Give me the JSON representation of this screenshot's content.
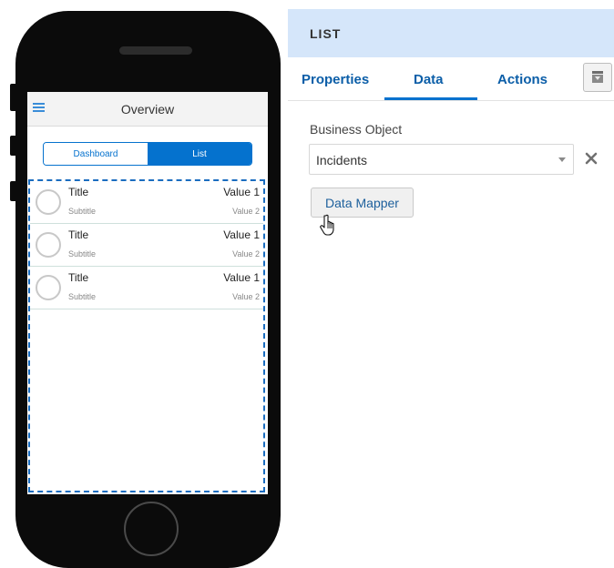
{
  "phone": {
    "header": {
      "title": "Overview",
      "menu_icon": "hamburger-icon"
    },
    "segments": [
      {
        "label": "Dashboard",
        "selected": false
      },
      {
        "label": "List",
        "selected": true
      }
    ],
    "list_items": [
      {
        "title": "Title",
        "subtitle": "Subtitle",
        "value1": "Value 1",
        "value2": "Value 2"
      },
      {
        "title": "Title",
        "subtitle": "Subtitle",
        "value1": "Value 1",
        "value2": "Value 2"
      },
      {
        "title": "Title",
        "subtitle": "Subtitle",
        "value1": "Value 1",
        "value2": "Value 2"
      }
    ]
  },
  "panel": {
    "title": "LIST",
    "tabs": [
      {
        "label": "Properties",
        "active": false
      },
      {
        "label": "Data",
        "active": true
      },
      {
        "label": "Actions",
        "active": false
      }
    ],
    "tab_icon": "palette-icon",
    "business_object": {
      "label": "Business Object",
      "value": "Incidents",
      "clear_icon": "close-icon"
    },
    "data_mapper_label": "Data Mapper",
    "cursor": "hand-pointer-icon"
  },
  "colors": {
    "accent": "#0572ce",
    "panel_header_bg": "#d5e6fa",
    "tab_text": "#0b5ea8",
    "phone_body": "#0b0b0b"
  }
}
